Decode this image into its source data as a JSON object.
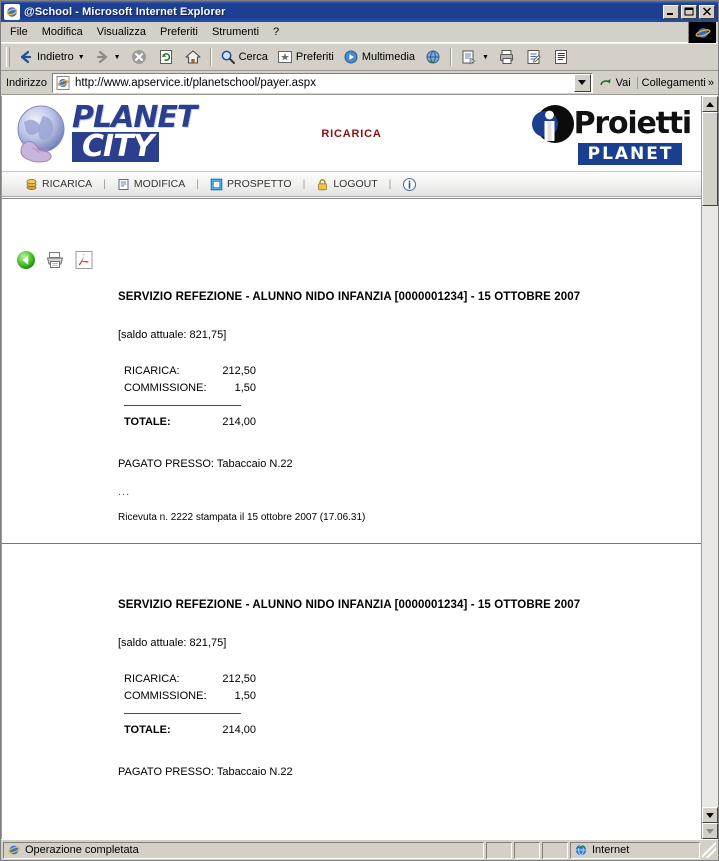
{
  "window": {
    "title": "@School - Microsoft Internet Explorer",
    "minimize_label": "Minimize",
    "maximize_label": "Maximize",
    "close_label": "Close"
  },
  "menubar": {
    "items": [
      {
        "label": "File"
      },
      {
        "label": "Modifica"
      },
      {
        "label": "Visualizza"
      },
      {
        "label": "Preferiti"
      },
      {
        "label": "Strumenti"
      },
      {
        "label": "?"
      }
    ]
  },
  "toolbar": {
    "back_label": "Indietro",
    "forward_label": "",
    "stop_label": "",
    "refresh_label": "",
    "home_label": "",
    "search_label": "Cerca",
    "favorites_label": "Preferiti",
    "media_label": "Multimedia",
    "history_label": "",
    "mail_label": "",
    "print_label": "",
    "edit_label": "",
    "discuss_label": ""
  },
  "address": {
    "label": "Indirizzo",
    "url": "http://www.apservice.it/planetschool/payer.aspx",
    "go_label": "Vai",
    "links_label": "Collegamenti",
    "chevron": "»"
  },
  "banner": {
    "logo_left_line1": "PLANET",
    "logo_left_line2": "CITY",
    "center_title": "RICARICA",
    "logo_right_word": "Proietti",
    "logo_right_bar": "PLANET"
  },
  "nav": {
    "items": [
      {
        "label": "RICARICA",
        "icon": "coins-icon"
      },
      {
        "label": "MODIFICA",
        "icon": "document-icon"
      },
      {
        "label": "PROSPETTO",
        "icon": "table-icon"
      },
      {
        "label": "LOGOUT",
        "icon": "lock-icon"
      }
    ],
    "separator": "|",
    "info_icon": "info-icon"
  },
  "actions": [
    {
      "name": "back-button",
      "icon": "green-back-arrow-icon"
    },
    {
      "name": "print-button",
      "icon": "printer-icon"
    },
    {
      "name": "pdf-button",
      "icon": "pdf-icon"
    }
  ],
  "receipts": [
    {
      "title": "SERVIZIO REFEZIONE - ALUNNO NIDO INFANZIA [0000001234] - 15 OTTOBRE 2007",
      "saldo": "[saldo attuale: 821,75]",
      "lines": [
        {
          "label": "RICARICA:",
          "value": "212,50"
        },
        {
          "label": "COMMISSIONE:",
          "value": "1,50"
        }
      ],
      "total_label": "TOTALE:",
      "total_value": "214,00",
      "pagato": "PAGATO PRESSO: Tabaccaio N.22",
      "dots": "...",
      "ricevuta": "Ricevuta n. 2222 stampata il 15 ottobre 2007 (17.06.31)"
    },
    {
      "title": "SERVIZIO REFEZIONE - ALUNNO NIDO INFANZIA [0000001234] - 15 OTTOBRE 2007",
      "saldo": "[saldo attuale: 821,75]",
      "lines": [
        {
          "label": "RICARICA:",
          "value": "212,50"
        },
        {
          "label": "COMMISSIONE:",
          "value": "1,50"
        }
      ],
      "total_label": "TOTALE:",
      "total_value": "214,00",
      "pagato": "PAGATO PRESSO: Tabaccaio N.22",
      "dots": "",
      "ricevuta": ""
    }
  ],
  "statusbar": {
    "message": "Operazione completata",
    "zone": "Internet"
  },
  "colors": {
    "titlebar_blue": "#1c3f94",
    "brand_blue": "#2b3f8c",
    "banner_title_red": "#8a1111",
    "chrome_gray": "#d4d0c8"
  }
}
